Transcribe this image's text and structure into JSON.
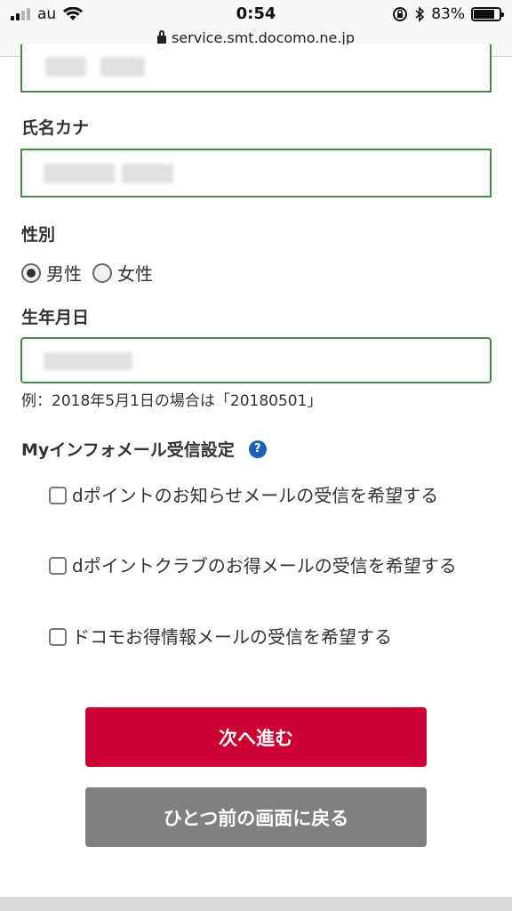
{
  "status_bar": {
    "carrier": "au",
    "time": "0:54",
    "battery_percent": "83%",
    "battery_level": 0.83,
    "url": "service.smt.docomo.ne.jp"
  },
  "form": {
    "kana_label": "氏名カナ",
    "gender_label": "性別",
    "gender_options": [
      "男性",
      "女性"
    ],
    "gender_selected": "男性",
    "birth_label": "生年月日",
    "birth_hint": "例：2018年5月1日の場合は「20180501」",
    "mail_section_title": "Myインフォメール受信設定",
    "help_icon_text": "?",
    "checkboxes": [
      {
        "label": "dポイントのお知らせメールの受信を希望する",
        "checked": false
      },
      {
        "label": "dポイントクラブのお得メールの受信を希望する",
        "checked": false
      },
      {
        "label": "ドコモお得情報メールの受信を希望する",
        "checked": false
      }
    ]
  },
  "buttons": {
    "next": "次へ進む",
    "back": "ひとつ前の画面に戻る"
  },
  "colors": {
    "primary": "#cc0033",
    "secondary": "#808080",
    "field_border": "#4a8a4a",
    "help_icon": "#1c5fb7"
  }
}
